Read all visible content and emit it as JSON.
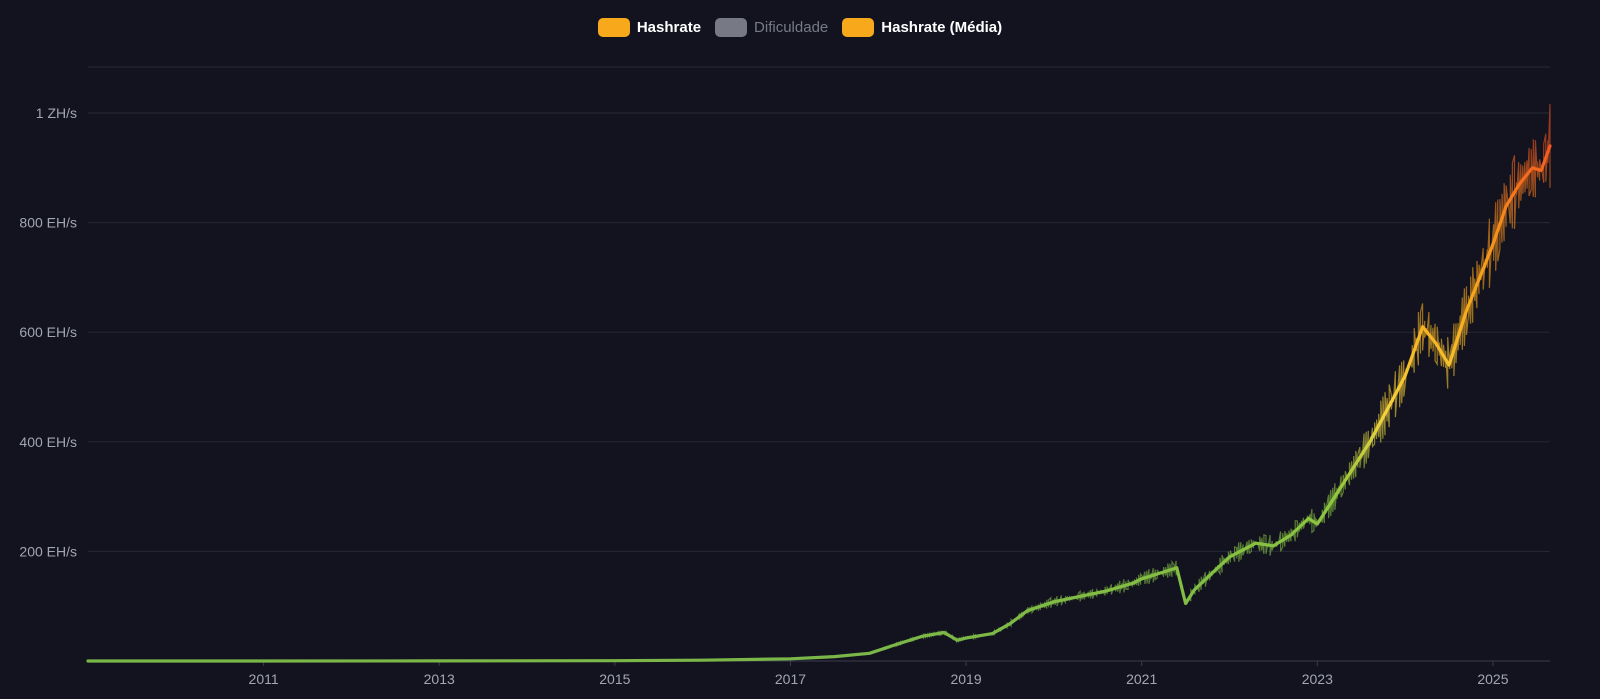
{
  "legend": [
    {
      "label": "Hashrate",
      "color": "#f7a91b",
      "enabled": true
    },
    {
      "label": "Dificuldade",
      "color": "#777a85",
      "enabled": false
    },
    {
      "label": "Hashrate (Média)",
      "color": "#f7a91b",
      "enabled": true
    }
  ],
  "chart_data": {
    "type": "line",
    "xlabel": "",
    "ylabel": "",
    "xlim": [
      2009.0,
      2025.65
    ],
    "ylim": [
      0,
      1000
    ],
    "grid": true,
    "legend_position": "top-center",
    "x_ticks": [
      {
        "value": 2011,
        "label": "2011"
      },
      {
        "value": 2013,
        "label": "2013"
      },
      {
        "value": 2015,
        "label": "2015"
      },
      {
        "value": 2017,
        "label": "2017"
      },
      {
        "value": 2019,
        "label": "2019"
      },
      {
        "value": 2021,
        "label": "2021"
      },
      {
        "value": 2023,
        "label": "2023"
      },
      {
        "value": 2025,
        "label": "2025"
      }
    ],
    "y_ticks": [
      {
        "value": 200,
        "label": "200 EH/s"
      },
      {
        "value": 400,
        "label": "400 EH/s"
      },
      {
        "value": 600,
        "label": "600 EH/s"
      },
      {
        "value": 800,
        "label": "800 EH/s"
      },
      {
        "value": 1000,
        "label": "1 ZH/s"
      }
    ],
    "series": [
      {
        "name": "Hashrate (Média)",
        "x": [
          2009.0,
          2011.0,
          2013.0,
          2015.0,
          2016.0,
          2017.0,
          2017.5,
          2017.9,
          2018.2,
          2018.5,
          2018.75,
          2018.9,
          2019.0,
          2019.3,
          2019.5,
          2019.7,
          2020.0,
          2020.3,
          2020.6,
          2020.9,
          2021.0,
          2021.3,
          2021.4,
          2021.5,
          2021.6,
          2021.8,
          2022.0,
          2022.3,
          2022.5,
          2022.7,
          2022.9,
          2023.0,
          2023.2,
          2023.4,
          2023.6,
          2023.8,
          2024.0,
          2024.2,
          2024.35,
          2024.5,
          2024.7,
          2024.85,
          2025.0,
          2025.15,
          2025.3,
          2025.45,
          2025.55,
          2025.65
        ],
        "values": [
          0,
          0,
          0.2,
          0.5,
          1.5,
          4,
          8,
          14,
          30,
          45,
          52,
          38,
          42,
          50,
          68,
          92,
          108,
          118,
          128,
          142,
          150,
          165,
          170,
          105,
          130,
          160,
          190,
          215,
          210,
          230,
          260,
          250,
          300,
          350,
          400,
          460,
          520,
          610,
          580,
          540,
          640,
          700,
          760,
          830,
          870,
          900,
          895,
          940
        ]
      }
    ],
    "color_scale": [
      {
        "value": 0,
        "color": "#7ab648"
      },
      {
        "value": 300,
        "color": "#8dc63f"
      },
      {
        "value": 450,
        "color": "#f5d33b"
      },
      {
        "value": 650,
        "color": "#f7a91b"
      },
      {
        "value": 800,
        "color": "#f58c1b"
      },
      {
        "value": 950,
        "color": "#f2531f"
      }
    ]
  }
}
